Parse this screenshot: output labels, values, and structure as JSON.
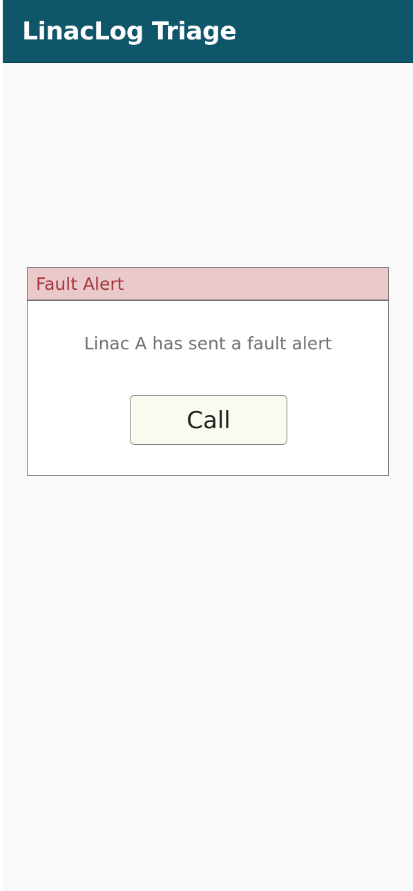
{
  "app": {
    "title": "LinacLog Triage"
  },
  "alert_dialog": {
    "title": "Fault Alert",
    "message": "Linac A has sent a fault alert",
    "call_button_label": "Call"
  },
  "colors": {
    "app_bar": "#10566b",
    "dialog_header": "#eac9ca",
    "dialog_title": "#a4373d",
    "button_background": "#f9fbf1"
  }
}
